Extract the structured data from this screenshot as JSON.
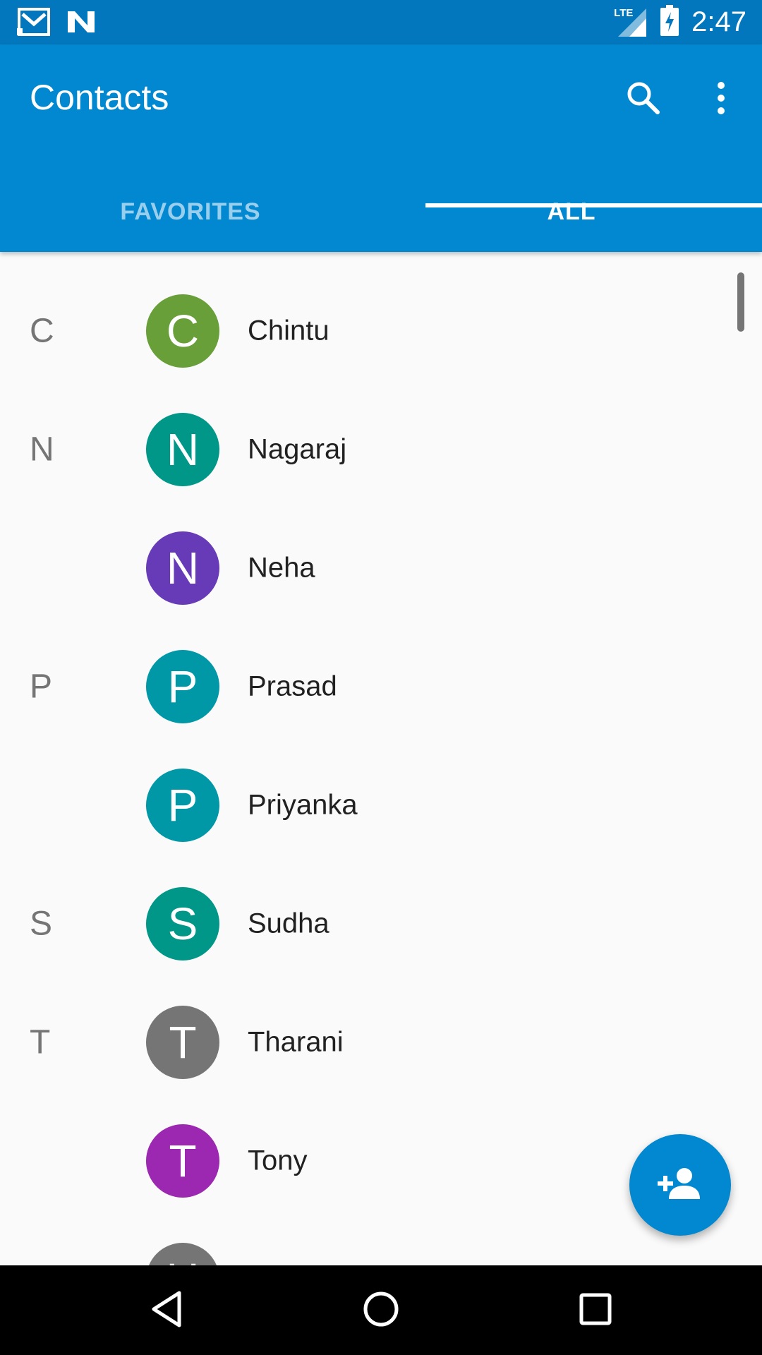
{
  "status_bar": {
    "time": "2:47",
    "network_label": "LTE",
    "icons": [
      "gmail-icon",
      "n-app-icon",
      "lte-signal-icon",
      "battery-charging-icon"
    ]
  },
  "app_bar": {
    "title": "Contacts",
    "actions": [
      "search-icon",
      "more-vert-icon"
    ]
  },
  "tabs": [
    {
      "label": "FAVORITES",
      "selected": false
    },
    {
      "label": "ALL",
      "selected": true
    }
  ],
  "contacts": [
    {
      "section_letter": "C",
      "initial": "C",
      "name": "Chintu",
      "color": "#689f38"
    },
    {
      "section_letter": "N",
      "initial": "N",
      "name": "Nagaraj",
      "color": "#009688"
    },
    {
      "section_letter": "",
      "initial": "N",
      "name": "Neha",
      "color": "#673ab7"
    },
    {
      "section_letter": "P",
      "initial": "P",
      "name": "Prasad",
      "color": "#0097a7"
    },
    {
      "section_letter": "",
      "initial": "P",
      "name": "Priyanka",
      "color": "#0097a7"
    },
    {
      "section_letter": "S",
      "initial": "S",
      "name": "Sudha",
      "color": "#009688"
    },
    {
      "section_letter": "T",
      "initial": "T",
      "name": "Tharani",
      "color": "#757575"
    },
    {
      "section_letter": "",
      "initial": "T",
      "name": "Tony",
      "color": "#9c27b0"
    },
    {
      "section_letter": "",
      "initial": "U",
      "name": "",
      "color": "#757575"
    }
  ],
  "fab": {
    "icon": "add-person-icon",
    "color": "#0288d1"
  },
  "nav_bar": {
    "buttons": [
      "back-icon",
      "home-icon",
      "recents-icon"
    ]
  },
  "colors": {
    "status_bar": "#0277bd",
    "app_bar": "#0288d1",
    "background": "#fafafa"
  }
}
